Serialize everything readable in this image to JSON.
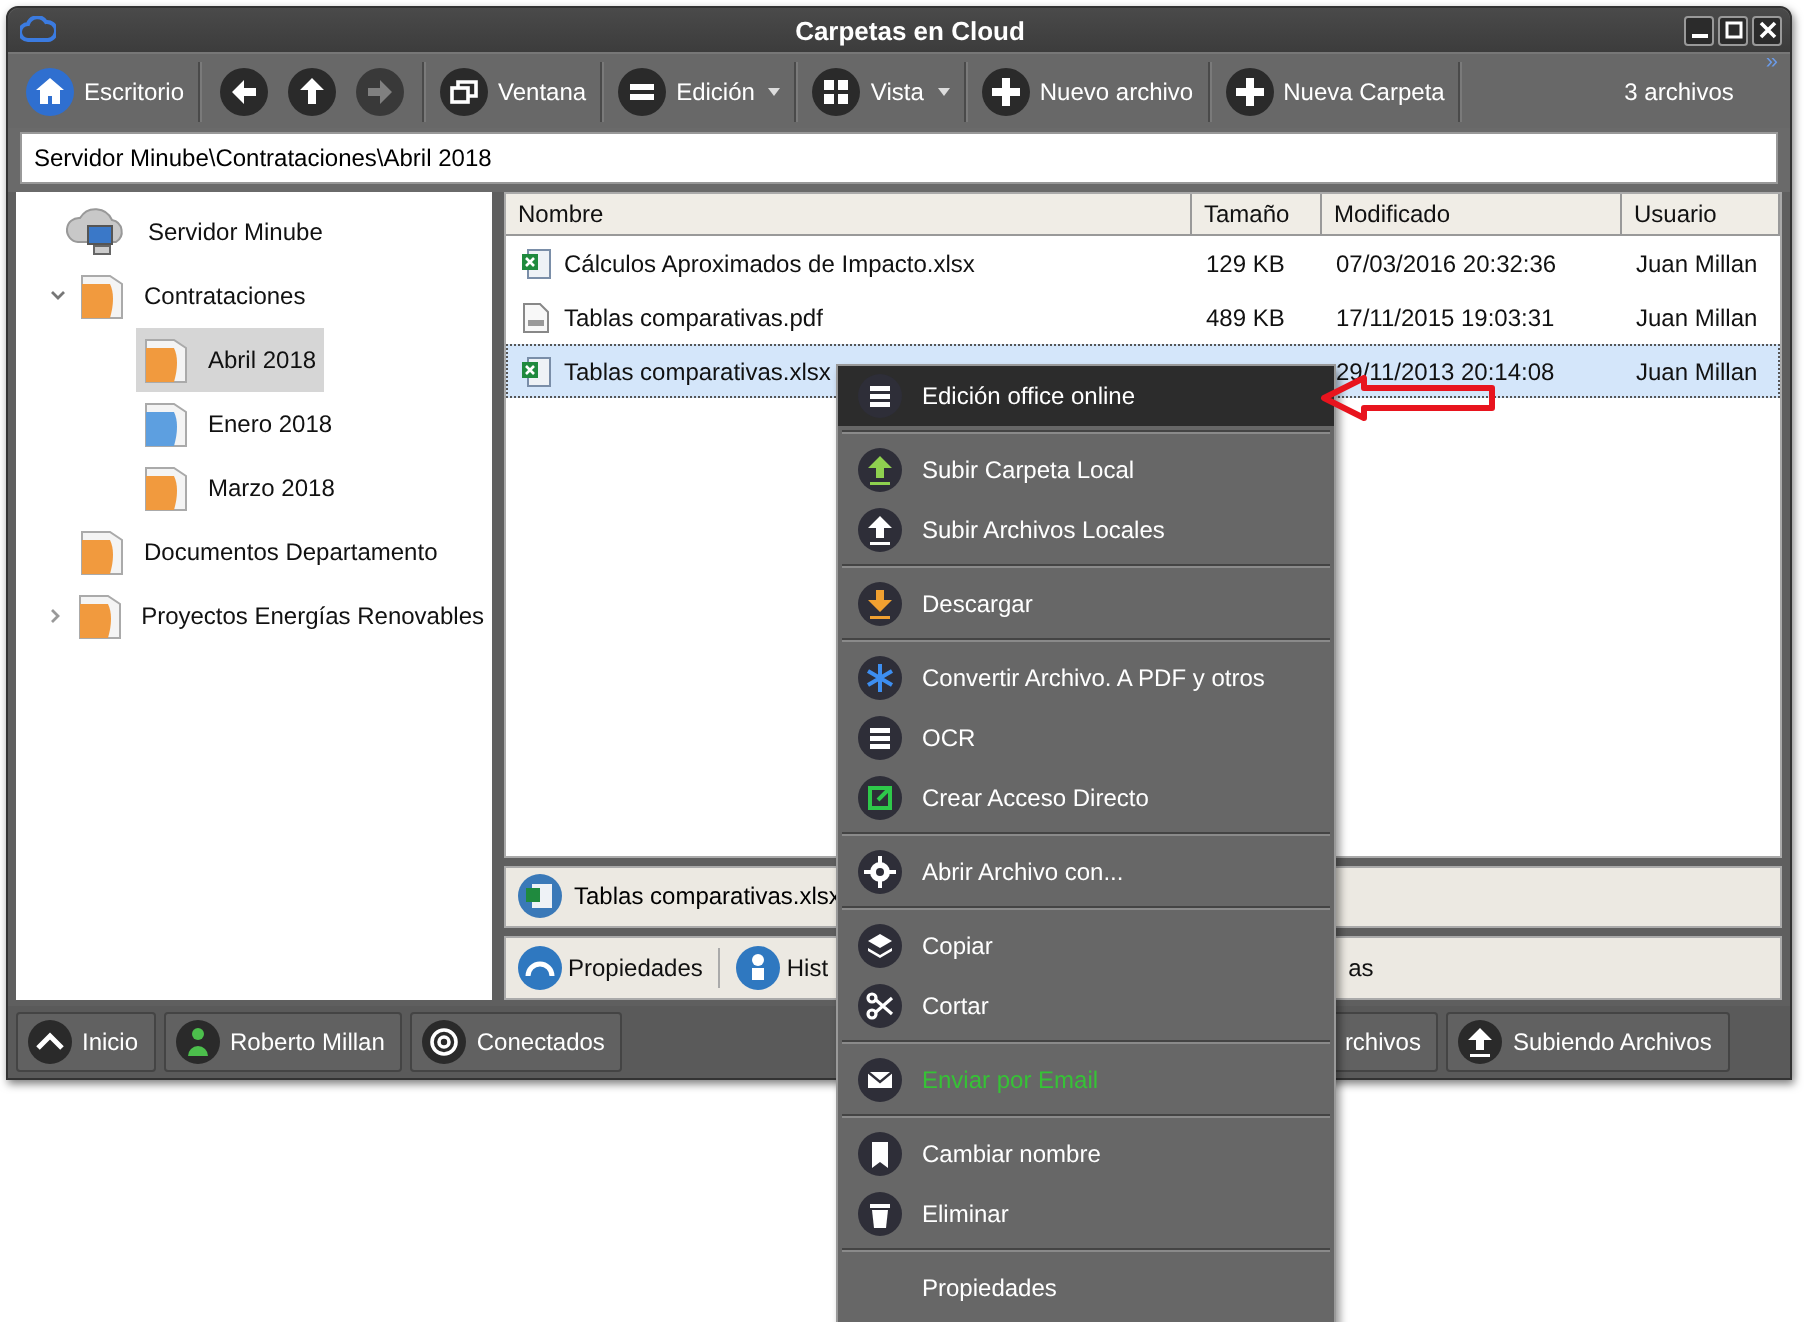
{
  "window": {
    "title": "Carpetas en Cloud"
  },
  "toolbar": {
    "buttons": [
      {
        "label": "Escritorio",
        "disabled": false,
        "dropdown": false
      },
      {
        "disabled": false,
        "dropdown": false
      },
      {
        "disabled": false,
        "dropdown": false
      },
      {
        "disabled": true,
        "dropdown": false
      },
      {
        "label": "Ventana",
        "disabled": false,
        "dropdown": false
      },
      {
        "label": "Edición",
        "disabled": false,
        "dropdown": true
      },
      {
        "label": "Vista",
        "disabled": false,
        "dropdown": true
      },
      {
        "label": "Nuevo archivo",
        "disabled": false,
        "dropdown": false
      },
      {
        "label": "Nueva Carpeta",
        "disabled": false,
        "dropdown": false
      }
    ],
    "count": "3 archivos",
    "overflow": "»"
  },
  "path": "Servidor Minube\\Contrataciones\\Abril 2018",
  "tree": [
    {
      "label": "Servidor Minube",
      "kind": "server",
      "expandable": false,
      "selected": false,
      "children": [
        {
          "label": "Contrataciones",
          "kind": "folder",
          "color": "#f19a3e",
          "expandable": true,
          "expanded": true,
          "selected": false,
          "children": [
            {
              "label": "Abril 2018",
              "kind": "folder",
              "color": "#f19a3e",
              "expandable": false,
              "selected": true
            },
            {
              "label": "Enero 2018",
              "kind": "folder",
              "color": "#5d9fe0",
              "expandable": false,
              "selected": false
            },
            {
              "label": "Marzo 2018",
              "kind": "folder",
              "color": "#f19a3e",
              "expandable": false,
              "selected": false
            }
          ]
        },
        {
          "label": "Documentos Departamento",
          "kind": "folder",
          "color": "#f19a3e",
          "expandable": false,
          "selected": false
        },
        {
          "label": "Proyectos Energías Renovables",
          "kind": "folder",
          "color": "#f19a3e",
          "expandable": true,
          "expanded": false,
          "selected": false
        }
      ]
    }
  ],
  "table": {
    "columns": [
      "Nombre",
      "Tamaño",
      "Modificado",
      "Usuario"
    ],
    "rows": [
      {
        "kind": "xlsx",
        "selected": false,
        "name": "Cálculos Aproximados de Impacto.xlsx",
        "size": "129 KB",
        "modified": "07/03/2016 20:32:36",
        "user": "Juan Millan"
      },
      {
        "kind": "pdf",
        "selected": false,
        "name": "Tablas comparativas.pdf",
        "size": "489 KB",
        "modified": "17/11/2015 19:03:31",
        "user": "Juan Millan"
      },
      {
        "kind": "xlsx",
        "selected": true,
        "name": "Tablas comparativas.xlsx",
        "modified": "29/11/2013 20:14:08",
        "user": "Juan Millan"
      }
    ]
  },
  "detail": {
    "file": "Tablas comparativas.xlsx",
    "tabs": [
      "Propiedades",
      "Hist",
      "as"
    ]
  },
  "status_bar": [
    "Inicio",
    "Roberto Millan",
    "Conectados",
    "rchivos",
    "Subiendo Archivos"
  ],
  "context_menu": {
    "sections": [
      {
        "items": [
          {
            "label": "Edición office online",
            "highlighted": true,
            "accent": false
          }
        ]
      },
      {
        "items": [
          {
            "label": "Subir Carpeta Local",
            "highlighted": false,
            "accent": false
          },
          {
            "label": "Subir Archivos Locales",
            "highlighted": false,
            "accent": false
          }
        ]
      },
      {
        "items": [
          {
            "label": "Descargar",
            "highlighted": false,
            "accent": false
          }
        ]
      },
      {
        "items": [
          {
            "label": "Convertir Archivo. A PDF y otros",
            "highlighted": false,
            "accent": false
          },
          {
            "label": "OCR",
            "highlighted": false,
            "accent": false
          },
          {
            "label": "Crear Acceso Directo",
            "highlighted": false,
            "accent": false
          }
        ]
      },
      {
        "items": [
          {
            "label": "Abrir Archivo con...",
            "highlighted": false,
            "accent": false
          }
        ]
      },
      {
        "items": [
          {
            "label": "Copiar",
            "highlighted": false,
            "accent": false
          },
          {
            "label": "Cortar",
            "highlighted": false,
            "accent": false
          }
        ]
      },
      {
        "items": [
          {
            "label": "Enviar por Email",
            "highlighted": false,
            "accent": true
          }
        ]
      },
      {
        "items": [
          {
            "label": "Cambiar nombre",
            "highlighted": false,
            "accent": false
          },
          {
            "label": "Eliminar",
            "highlighted": false,
            "accent": false
          }
        ]
      },
      {
        "items": [
          {
            "label": "Propiedades",
            "highlighted": false,
            "accent": false
          }
        ]
      }
    ]
  }
}
